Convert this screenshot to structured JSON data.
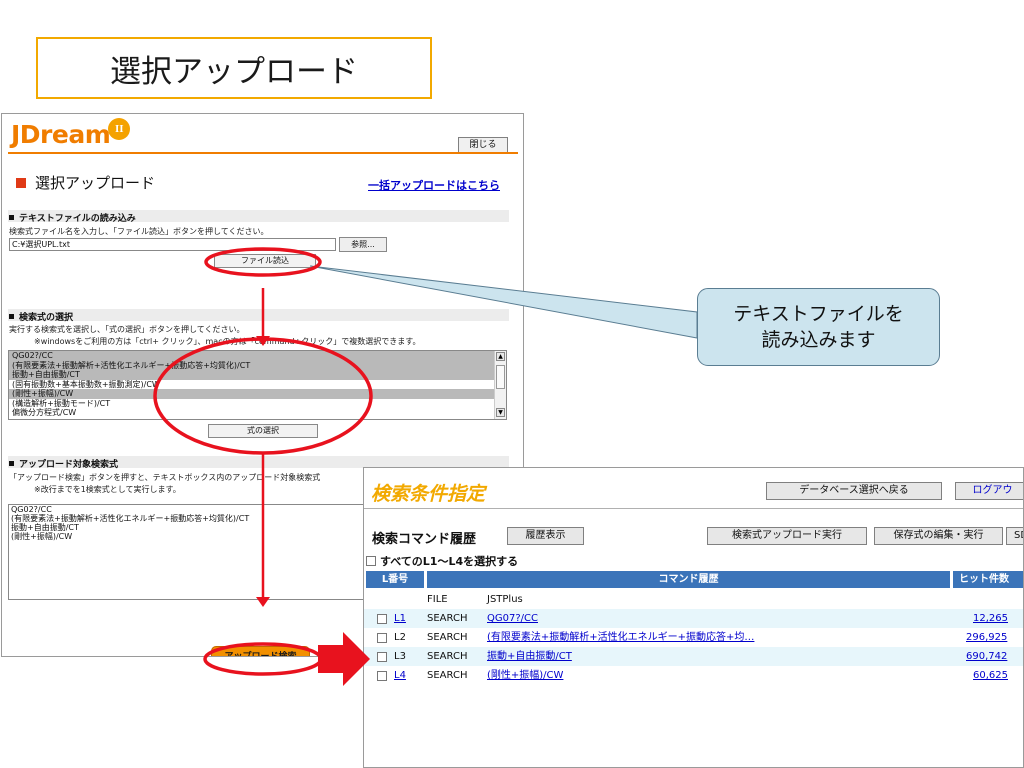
{
  "slide_title": "選択アップロード",
  "callout": {
    "line1": "テキストファイルを",
    "line2": "読み込みます"
  },
  "jdream": {
    "logo_text": "JDream",
    "logo_mark": "II",
    "close_label": "閉じる",
    "panel_title": "選択アップロード",
    "bulk_link": "一括アップロードはこちら",
    "section1": {
      "heading": "テキストファイルの読み込み",
      "instruction": "検索式ファイル名を入力し、「ファイル読込」ボタンを押してください。",
      "file_value": "C:¥選択UPL.txt",
      "browse_label": "参照...",
      "read_label": "ファイル読込"
    },
    "section2": {
      "heading": "検索式の選択",
      "instruction": "実行する検索式を選択し、「式の選択」ボタンを押してください。",
      "note": "※windowsをご利用の方は「ctrl+ クリック」、macの方は「command+クリック」で複数選択できます。",
      "options": [
        "QG02?/CC",
        "(有限要素法+振動解析+活性化エネルギー+振動応答+均質化)/CT",
        "振動+自由振動/CT",
        "(固有振動数+基本振動数+振動測定)/CW",
        "(剛性+振幅)/CW",
        "(構造解析+振動モード)/CT",
        "偏微分方程式/CW"
      ],
      "select_label": "式の選択"
    },
    "section3": {
      "heading": "アップロード対象検索式",
      "instruction": "「アップロード検索」ボタンを押すと、テキストボックス内のアップロード対象検索式",
      "note": "※改行までを1検索式として実行します。",
      "content": [
        "QG02?/CC",
        "(有限要素法+振動解析+活性化エネルギー+振動応答+均質化)/CT",
        "振動+自由振動/CT",
        "(剛性+振幅)/CW"
      ],
      "upload_label": "アップロード検索"
    }
  },
  "search": {
    "title": "検索条件指定",
    "db_back": "データベース選択へ戻る",
    "logout": "ログアウ",
    "history_label": "検索コマンド履歴",
    "history_button": "履歴表示",
    "upload_exec": "検索式アップロード実行",
    "saved_edit": "保存式の編集・実行",
    "sd_btn": "SD",
    "select_all": "すべてのL1〜L4を選択する",
    "columns": [
      "L番号",
      "コマンド履歴",
      "ヒット件数"
    ],
    "rows": [
      {
        "l": "",
        "type": "FILE",
        "cmd": "JSTPlus",
        "hits": ""
      },
      {
        "l": "L1",
        "type": "SEARCH",
        "cmd": "QG07?/CC",
        "hits": "12,265"
      },
      {
        "l": "L2",
        "type": "SEARCH",
        "cmd": "(有限要素法+振動解析+活性化エネルギー+振動応答+均…",
        "hits": "296,925"
      },
      {
        "l": "L3",
        "type": "SEARCH",
        "cmd": "振動+自由振動/CT",
        "hits": "690,742"
      },
      {
        "l": "L4",
        "type": "SEARCH",
        "cmd": "(剛性+振幅)/CW",
        "hits": "60,625"
      }
    ]
  },
  "colors": {
    "accent_orange": "#f07d00",
    "highlight_red": "#e8121e",
    "table_header": "#3b74b9",
    "callout_bg": "#cce4ee"
  },
  "icons": [
    "jdream-logo",
    "scroll-up-icon",
    "scroll-down-icon",
    "red-arrow-right-icon",
    "down-arrow-icon"
  ]
}
